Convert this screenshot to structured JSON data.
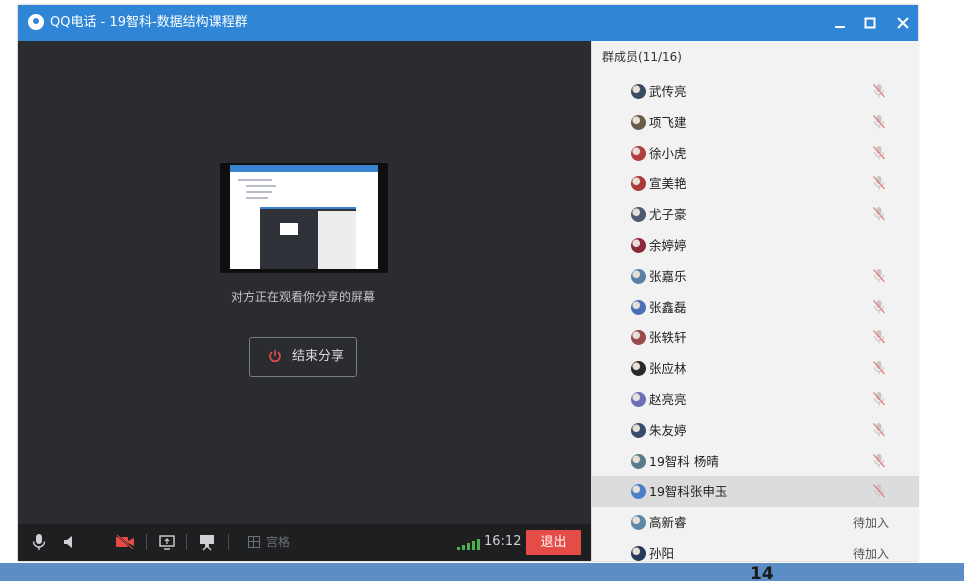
{
  "window": {
    "title": "QQ电话 - 19智科-数据结构课程群",
    "controls": [
      "minimize-icon",
      "maximize-icon",
      "close-icon"
    ],
    "accent_color": "#2f86d6"
  },
  "share": {
    "status_text": "对方正在观看你分享的屏幕",
    "end_share_label": "结束分享",
    "power_icon": "power-icon"
  },
  "toolbar": {
    "grid_label": "宫格",
    "time": "16:12",
    "exit_label": "退出",
    "exit_color": "#e64c47",
    "icons": [
      "microphone-icon",
      "speaker-icon",
      "camera-off-icon",
      "screen-share-icon",
      "presenter-icon",
      "grid-icon",
      "signal-icon"
    ]
  },
  "members": {
    "header": "群成员(11/16)",
    "items": [
      {
        "name": "武传亮",
        "muted": true
      },
      {
        "name": "项飞建",
        "muted": true
      },
      {
        "name": "徐小虎",
        "muted": true
      },
      {
        "name": "宣美艳",
        "muted": true
      },
      {
        "name": "尤子豪",
        "muted": true
      },
      {
        "name": "余婷婷",
        "muted": false
      },
      {
        "name": "张嘉乐",
        "muted": true
      },
      {
        "name": "张鑫磊",
        "muted": true
      },
      {
        "name": "张轶轩",
        "muted": true
      },
      {
        "name": "张应林",
        "muted": true
      },
      {
        "name": "赵亮亮",
        "muted": true
      },
      {
        "name": "朱友婷",
        "muted": true
      },
      {
        "name": "19智科 杨晴",
        "muted": true
      },
      {
        "name": "19智科张申玉",
        "muted": true,
        "selected": true
      },
      {
        "name": "高新睿",
        "status": "待加入"
      },
      {
        "name": "孙阳",
        "status": "待加入"
      }
    ]
  },
  "page_number": "14"
}
